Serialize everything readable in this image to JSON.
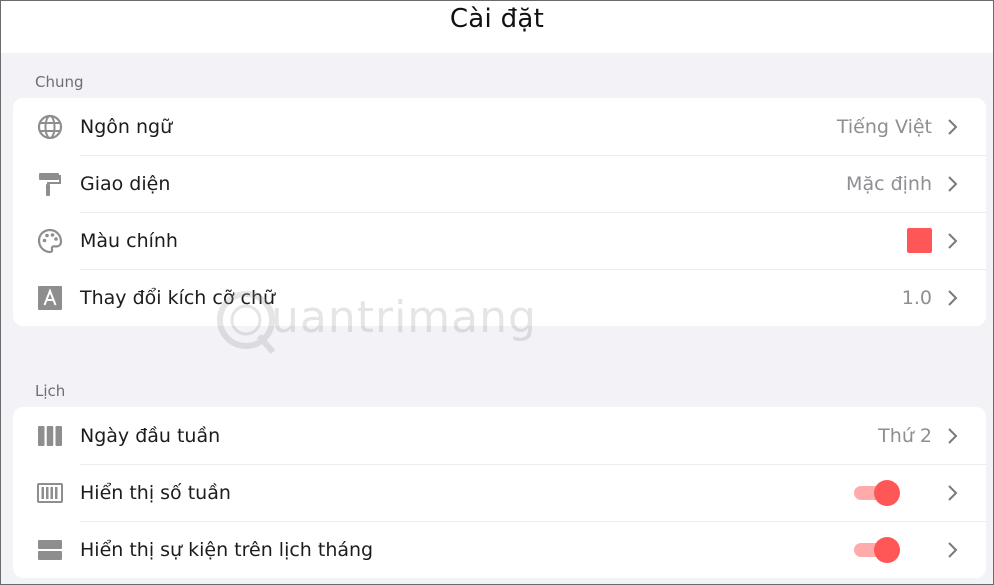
{
  "header": {
    "title": "Cài đặt"
  },
  "accent_color": "#ff5757",
  "sections": [
    {
      "label": "Chung",
      "rows": [
        {
          "icon": "globe-icon",
          "label": "Ngôn ngữ",
          "value": "Tiếng Việt"
        },
        {
          "icon": "paint-roller-icon",
          "label": "Giao diện",
          "value": "Mặc định"
        },
        {
          "icon": "palette-icon",
          "label": "Màu chính",
          "swatch_color": "#ff5757"
        },
        {
          "icon": "font-size-icon",
          "label": "Thay đổi kích cỡ chữ",
          "value": "1.0"
        }
      ]
    },
    {
      "label": "Lịch",
      "rows": [
        {
          "icon": "columns-icon",
          "label": "Ngày đầu tuần",
          "value": "Thứ 2"
        },
        {
          "icon": "week-number-icon",
          "label": "Hiển thị số tuần",
          "toggle_on": true
        },
        {
          "icon": "rows-icon",
          "label": "Hiển thị sự kiện trên lịch tháng",
          "toggle_on": true
        }
      ]
    }
  ],
  "watermark": {
    "text": "uantrimang"
  }
}
